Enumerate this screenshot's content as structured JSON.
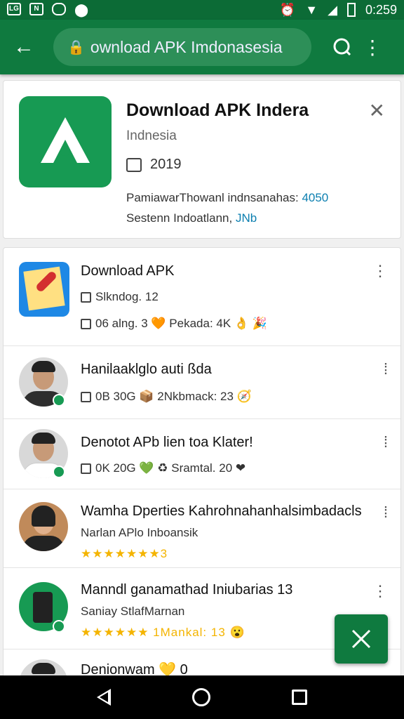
{
  "status": {
    "time": "0:259",
    "icons": [
      "LG",
      "N",
      "msg",
      "pin"
    ]
  },
  "toolbar": {
    "url_text": "ownload APK Imdonasesia"
  },
  "top_card": {
    "title": "Download APK Indera",
    "subtitle": "Indnesia",
    "year": "2019",
    "desc_line1_a": "PamiawarThowanl indnsanahas:",
    "desc_line1_b": "4050",
    "desc_line2_a": "Sestenn Indoatlann,",
    "desc_line2_b": "JNb"
  },
  "list": [
    {
      "title": "Download APK",
      "line1": "Slkndog.  12",
      "line2": "06 alng.  3 🧡 Pekada: 4K 👌 🎉"
    },
    {
      "title": "Hanilaaklglo auti ßda",
      "line1": "0B 30G 📦 2Nkbmack: 23 🧭"
    },
    {
      "title": "Denotot APb lien toa Klater!",
      "line1": "0K 20G 💚 ♻ Sramtal. 20 ❤"
    },
    {
      "title": "Wamha Dperties Kahrohnahanhalsimbadacls",
      "line1": "Narlan APlo Inboansik",
      "stars": "★★★★★★★3"
    },
    {
      "title": "Manndl ganamathad Iniubarias  13",
      "line1": "Saniay StlafMarnan",
      "stars": "★★★★★★ 1Mankal:  13 😮"
    },
    {
      "title": "Denionwam 💛 0"
    }
  ],
  "colors": {
    "primary": "#0f7a3f",
    "accent_link": "#0c7fb0",
    "star": "#f4b400"
  }
}
